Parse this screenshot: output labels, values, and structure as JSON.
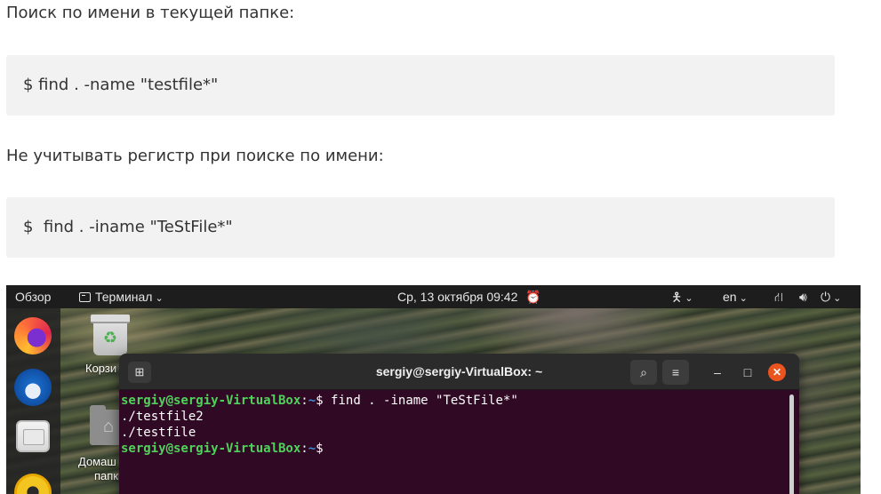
{
  "article": {
    "para1": "Поиск по имени в текущей папке:",
    "code1": "$ find . -name \"testfile*\"",
    "para2": "Не учитывать регистр при поиске по имени:",
    "code2": "$  find . -iname \"TeStFile*\""
  },
  "topbar": {
    "overview": "Обзор",
    "app_name": "Терминал",
    "clock": "Ср, 13 октября  09:42",
    "lang": "en",
    "icons": [
      "window-icon",
      "alarm-icon",
      "accessibility-icon",
      "network-icon",
      "volume-icon",
      "power-icon"
    ]
  },
  "desktop": {
    "trash_label": "Корзи",
    "home_label_1": "Домаш",
    "home_label_2": "папк"
  },
  "terminal": {
    "title": "sergiy@sergiy-VirtualBox: ~",
    "prompt_user": "sergiy@sergiy-VirtualBox",
    "prompt_sep": ":",
    "prompt_path": "~",
    "prompt_char": "$",
    "command": " find . -iname \"TeStFile*\"",
    "output": [
      "./testfile2",
      "./testfile"
    ]
  },
  "colors": {
    "prompt_user": "#4fd25a",
    "prompt_path": "#3f8fd8",
    "terminal_bg": "#300a24",
    "close_button": "#e9541f",
    "code_bg": "#f2f2f2"
  }
}
